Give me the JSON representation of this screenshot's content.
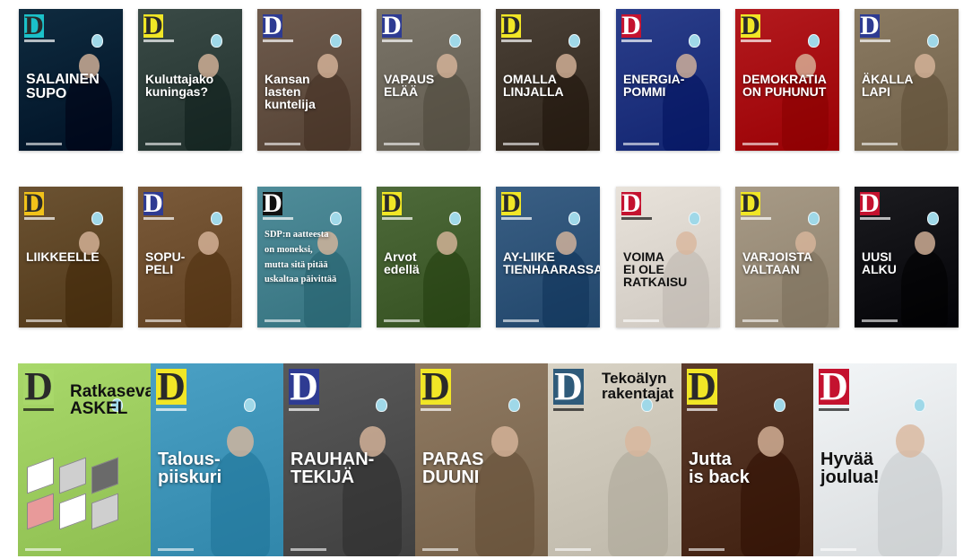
{
  "row1": [
    {
      "headline": "SALAINEN\nSUPO",
      "logo": "D",
      "logo_bg": "#1bc1c9",
      "bg": "#0f2b3f",
      "fg": "#ffffff"
    },
    {
      "headline": "Kuluttajako\nkuningas?",
      "logo": "D",
      "logo_bg": "#f1e626",
      "bg": "#3a4a46",
      "fg": "#ffffff"
    },
    {
      "headline": "Kansan\nlasten\nkuntelija",
      "logo": "D",
      "logo_bg": "#2e3b92",
      "bg": "#6e5b4d",
      "fg": "#ffffff"
    },
    {
      "headline": "VAPAUS\nELÄÄ",
      "logo": "D",
      "logo_bg": "#2e3b92",
      "bg": "#7a7468",
      "fg": "#ffffff"
    },
    {
      "headline": "OMALLA\nLINJALLA",
      "logo": "D",
      "logo_bg": "#f1e626",
      "bg": "#4a4036",
      "fg": "#ffffff"
    },
    {
      "headline": "ENERGIA-\nPOMMI",
      "logo": "D",
      "logo_bg": "#c4122f",
      "bg": "#2b3e8a",
      "fg": "#ffffff"
    },
    {
      "headline": "DEMOKRATIA\nON PUHUNUT",
      "logo": "D",
      "logo_bg": "#f1e626",
      "bg": "#b31a1e",
      "fg": "#ffffff"
    },
    {
      "headline": "ÄKALLA\nLAPI",
      "logo": "D",
      "logo_bg": "#2e3b92",
      "bg": "#8a7a62",
      "fg": "#ffffff"
    }
  ],
  "row2": [
    {
      "headline": "LIIKKEELLE",
      "logo": "D",
      "logo_bg": "#f1c21a",
      "bg": "#6b5232",
      "fg": "#ffffff"
    },
    {
      "headline": "SOPU-\nPELI",
      "logo": "D",
      "logo_bg": "#2e3b92",
      "bg": "#7a5a3a",
      "fg": "#ffffff"
    },
    {
      "headline": "SDP:n aatteesta\non moneksi,\nmutta sitä pitää\nuskaltaa päivittää",
      "logo": "D",
      "logo_bg": "#111111",
      "bg": "#4f8c99",
      "fg": "#ffffff"
    },
    {
      "headline": "Arvot\nedellä",
      "logo": "D",
      "logo_bg": "#f1e626",
      "bg": "#4e6a3a",
      "fg": "#ffffff"
    },
    {
      "headline": "AY-LIIKE\nTIENHAARASSA",
      "logo": "D",
      "logo_bg": "#f1e626",
      "bg": "#3a5f84",
      "fg": "#ffffff"
    },
    {
      "headline": "VOIMA\nEI OLE\nRATKAISU",
      "logo": "D",
      "logo_bg": "#c4122f",
      "bg": "#e8e2da",
      "fg": "#111111"
    },
    {
      "headline": "VARJOISTA\nVALTAAN",
      "logo": "D",
      "logo_bg": "#f1e626",
      "bg": "#a79a86",
      "fg": "#ffffff"
    },
    {
      "headline": "UUSI\nALKU",
      "logo": "D",
      "logo_bg": "#c4122f",
      "bg": "#1c1c20",
      "fg": "#ffffff"
    }
  ],
  "row3": [
    {
      "headline": "Ratkaseva\nASKEL",
      "logo": "D",
      "logo_bg": "#a8d86a",
      "bg": "#a8d86a",
      "fg": "#111111"
    },
    {
      "headline": "Talous-\npiiskuri",
      "logo": "D",
      "logo_bg": "#f1e626",
      "bg": "#4aa0c4",
      "fg": "#ffffff"
    },
    {
      "headline": "RAUHAN-\nTEKIJÄ",
      "logo": "D",
      "logo_bg": "#2e3b92",
      "bg": "#595959",
      "fg": "#ffffff"
    },
    {
      "headline": "PARAS\nDUUNI",
      "logo": "D",
      "logo_bg": "#f1e626",
      "bg": "#8f7a62",
      "fg": "#ffffff"
    },
    {
      "headline": "Tekoälyn\nrakentajat",
      "logo": "D",
      "logo_bg": "#2f5b7a",
      "bg": "#d8d2c4",
      "fg": "#111111"
    },
    {
      "headline": "Jutta\nis back",
      "logo": "D",
      "logo_bg": "#f1e626",
      "bg": "#5a3a2a",
      "fg": "#ffffff"
    },
    {
      "headline": "Hyvää\njoulua!",
      "logo": "D",
      "logo_bg": "#c4122f",
      "bg": "#f2f5f7",
      "fg": "#111111"
    }
  ]
}
